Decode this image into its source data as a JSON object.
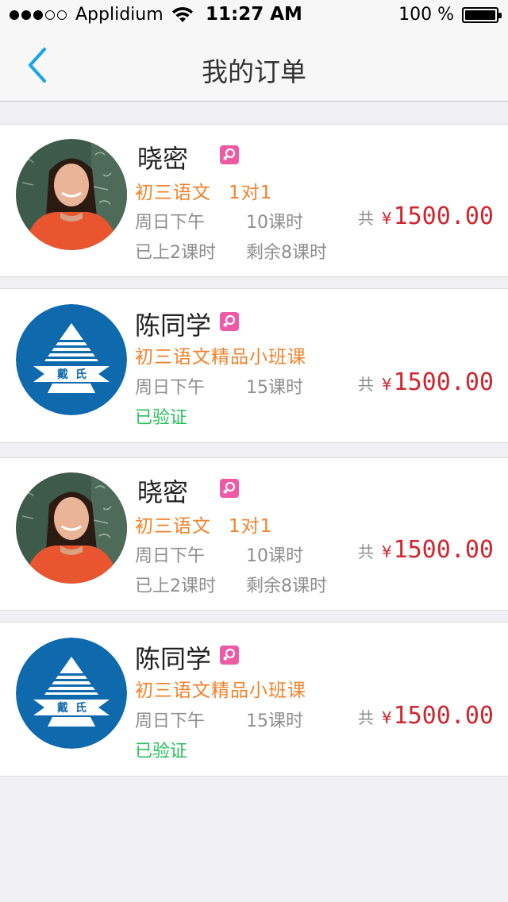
{
  "status_bar": {
    "carrier": "Applidium",
    "time": "11:27 AM",
    "battery": "100 %"
  },
  "nav": {
    "title": "我的订单",
    "back_icon": "chevron-left-icon"
  },
  "colors": {
    "accent": "#1aa3e8",
    "course": "#f0822b",
    "price": "#d0262e",
    "verified": "#27c05a",
    "badge": "#ee5aa6",
    "logo_blue": "#0f6aad"
  },
  "orders": [
    {
      "name": "晓密",
      "avatar": "teacher-photo",
      "course": "初三语文",
      "course_extra": "1对1",
      "schedule": "周日下午",
      "hours": "10课时",
      "price_label": "共",
      "currency": "¥",
      "price": "1500.00",
      "done": "已上2课时",
      "remaining": "剩余8课时"
    },
    {
      "name": "陈同学",
      "avatar": "school-logo",
      "course": "初三语文精品小班课",
      "schedule": "周日下午",
      "hours": "15课时",
      "price_label": "共",
      "currency": "¥",
      "price": "1500.00",
      "status": "已验证"
    },
    {
      "name": "晓密",
      "avatar": "teacher-photo",
      "course": "初三语文",
      "course_extra": "1对1",
      "schedule": "周日下午",
      "hours": "10课时",
      "price_label": "共",
      "currency": "¥",
      "price": "1500.00",
      "done": "已上2课时",
      "remaining": "剩余8课时"
    },
    {
      "name": "陈同学",
      "avatar": "school-logo",
      "course": "初三语文精品小班课",
      "schedule": "周日下午",
      "hours": "15课时",
      "price_label": "共",
      "currency": "¥",
      "price": "1500.00",
      "status": "已验证"
    }
  ]
}
